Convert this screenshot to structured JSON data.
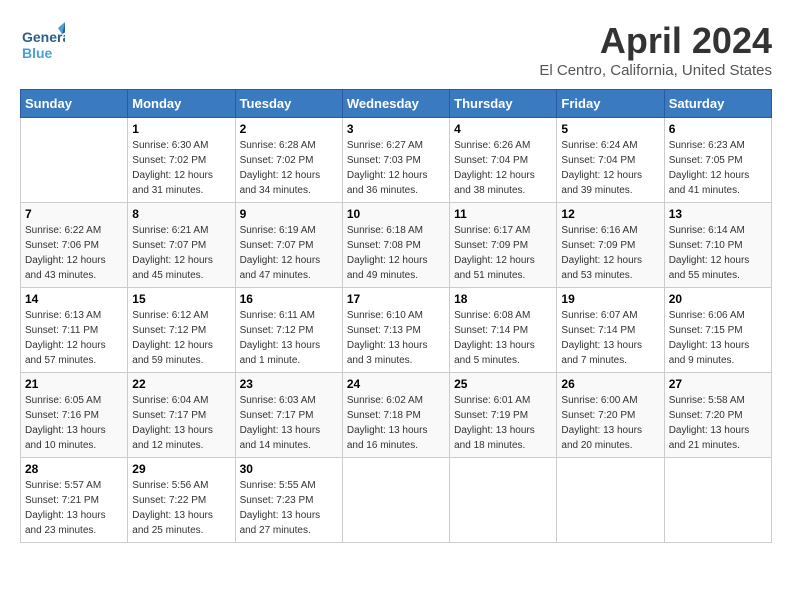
{
  "header": {
    "logo_general": "General",
    "logo_blue": "Blue",
    "title": "April 2024",
    "subtitle": "El Centro, California, United States"
  },
  "calendar": {
    "days_of_week": [
      "Sunday",
      "Monday",
      "Tuesday",
      "Wednesday",
      "Thursday",
      "Friday",
      "Saturday"
    ],
    "weeks": [
      [
        {
          "date": "",
          "info": ""
        },
        {
          "date": "1",
          "info": "Sunrise: 6:30 AM\nSunset: 7:02 PM\nDaylight: 12 hours\nand 31 minutes."
        },
        {
          "date": "2",
          "info": "Sunrise: 6:28 AM\nSunset: 7:02 PM\nDaylight: 12 hours\nand 34 minutes."
        },
        {
          "date": "3",
          "info": "Sunrise: 6:27 AM\nSunset: 7:03 PM\nDaylight: 12 hours\nand 36 minutes."
        },
        {
          "date": "4",
          "info": "Sunrise: 6:26 AM\nSunset: 7:04 PM\nDaylight: 12 hours\nand 38 minutes."
        },
        {
          "date": "5",
          "info": "Sunrise: 6:24 AM\nSunset: 7:04 PM\nDaylight: 12 hours\nand 39 minutes."
        },
        {
          "date": "6",
          "info": "Sunrise: 6:23 AM\nSunset: 7:05 PM\nDaylight: 12 hours\nand 41 minutes."
        }
      ],
      [
        {
          "date": "7",
          "info": "Sunrise: 6:22 AM\nSunset: 7:06 PM\nDaylight: 12 hours\nand 43 minutes."
        },
        {
          "date": "8",
          "info": "Sunrise: 6:21 AM\nSunset: 7:07 PM\nDaylight: 12 hours\nand 45 minutes."
        },
        {
          "date": "9",
          "info": "Sunrise: 6:19 AM\nSunset: 7:07 PM\nDaylight: 12 hours\nand 47 minutes."
        },
        {
          "date": "10",
          "info": "Sunrise: 6:18 AM\nSunset: 7:08 PM\nDaylight: 12 hours\nand 49 minutes."
        },
        {
          "date": "11",
          "info": "Sunrise: 6:17 AM\nSunset: 7:09 PM\nDaylight: 12 hours\nand 51 minutes."
        },
        {
          "date": "12",
          "info": "Sunrise: 6:16 AM\nSunset: 7:09 PM\nDaylight: 12 hours\nand 53 minutes."
        },
        {
          "date": "13",
          "info": "Sunrise: 6:14 AM\nSunset: 7:10 PM\nDaylight: 12 hours\nand 55 minutes."
        }
      ],
      [
        {
          "date": "14",
          "info": "Sunrise: 6:13 AM\nSunset: 7:11 PM\nDaylight: 12 hours\nand 57 minutes."
        },
        {
          "date": "15",
          "info": "Sunrise: 6:12 AM\nSunset: 7:12 PM\nDaylight: 12 hours\nand 59 minutes."
        },
        {
          "date": "16",
          "info": "Sunrise: 6:11 AM\nSunset: 7:12 PM\nDaylight: 13 hours\nand 1 minute."
        },
        {
          "date": "17",
          "info": "Sunrise: 6:10 AM\nSunset: 7:13 PM\nDaylight: 13 hours\nand 3 minutes."
        },
        {
          "date": "18",
          "info": "Sunrise: 6:08 AM\nSunset: 7:14 PM\nDaylight: 13 hours\nand 5 minutes."
        },
        {
          "date": "19",
          "info": "Sunrise: 6:07 AM\nSunset: 7:14 PM\nDaylight: 13 hours\nand 7 minutes."
        },
        {
          "date": "20",
          "info": "Sunrise: 6:06 AM\nSunset: 7:15 PM\nDaylight: 13 hours\nand 9 minutes."
        }
      ],
      [
        {
          "date": "21",
          "info": "Sunrise: 6:05 AM\nSunset: 7:16 PM\nDaylight: 13 hours\nand 10 minutes."
        },
        {
          "date": "22",
          "info": "Sunrise: 6:04 AM\nSunset: 7:17 PM\nDaylight: 13 hours\nand 12 minutes."
        },
        {
          "date": "23",
          "info": "Sunrise: 6:03 AM\nSunset: 7:17 PM\nDaylight: 13 hours\nand 14 minutes."
        },
        {
          "date": "24",
          "info": "Sunrise: 6:02 AM\nSunset: 7:18 PM\nDaylight: 13 hours\nand 16 minutes."
        },
        {
          "date": "25",
          "info": "Sunrise: 6:01 AM\nSunset: 7:19 PM\nDaylight: 13 hours\nand 18 minutes."
        },
        {
          "date": "26",
          "info": "Sunrise: 6:00 AM\nSunset: 7:20 PM\nDaylight: 13 hours\nand 20 minutes."
        },
        {
          "date": "27",
          "info": "Sunrise: 5:58 AM\nSunset: 7:20 PM\nDaylight: 13 hours\nand 21 minutes."
        }
      ],
      [
        {
          "date": "28",
          "info": "Sunrise: 5:57 AM\nSunset: 7:21 PM\nDaylight: 13 hours\nand 23 minutes."
        },
        {
          "date": "29",
          "info": "Sunrise: 5:56 AM\nSunset: 7:22 PM\nDaylight: 13 hours\nand 25 minutes."
        },
        {
          "date": "30",
          "info": "Sunrise: 5:55 AM\nSunset: 7:23 PM\nDaylight: 13 hours\nand 27 minutes."
        },
        {
          "date": "",
          "info": ""
        },
        {
          "date": "",
          "info": ""
        },
        {
          "date": "",
          "info": ""
        },
        {
          "date": "",
          "info": ""
        }
      ]
    ]
  }
}
